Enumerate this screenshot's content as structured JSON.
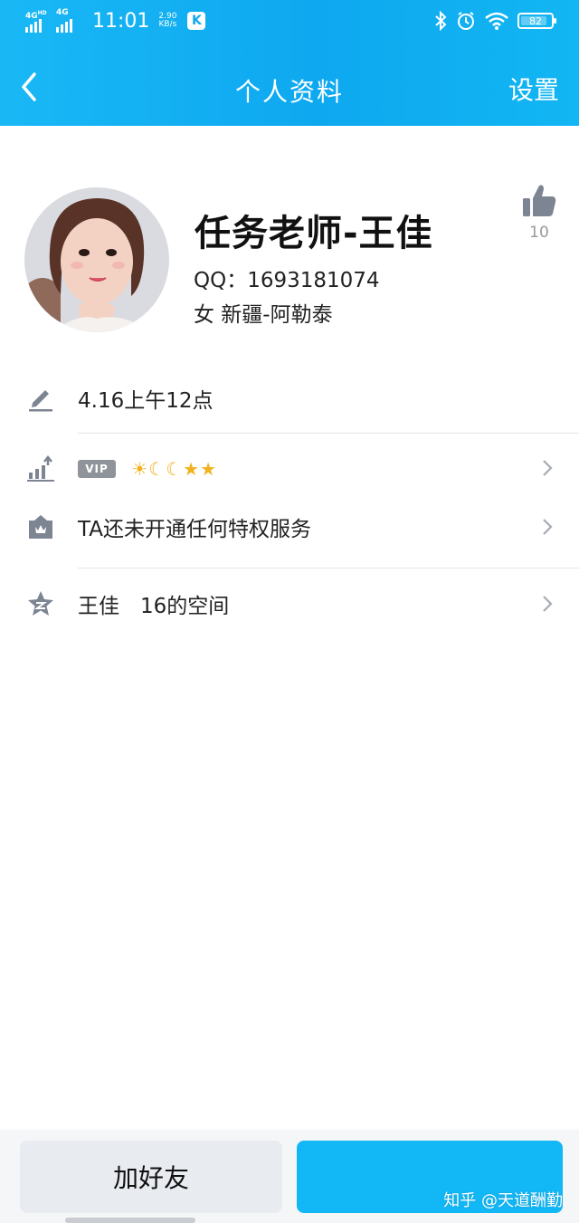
{
  "status_bar": {
    "net1": "4G",
    "net1_sup": "HD",
    "net2": "4G",
    "time": "11:01",
    "speed_value": "2.90",
    "speed_unit": "KB/s",
    "app_badge": "K",
    "battery": "82"
  },
  "nav": {
    "title": "个人资料",
    "settings_label": "设置"
  },
  "profile": {
    "name": "任务老师-王佳",
    "qq": "QQ：1693181074",
    "gender_location": "女  新疆-阿勒泰",
    "likes": "10"
  },
  "rows": {
    "signature": "4.16上午12点",
    "vip_badge": "VIP",
    "privilege": "TA还未开通任何特权服务",
    "space": "王佳　16的空间"
  },
  "bottom": {
    "add_friend": "加好友",
    "watermark": "知乎 @天道酬勤"
  },
  "colors": {
    "header_blue": "#12b4f2",
    "level_gold": "#f2b21f",
    "icon_gray": "#7d8593"
  }
}
